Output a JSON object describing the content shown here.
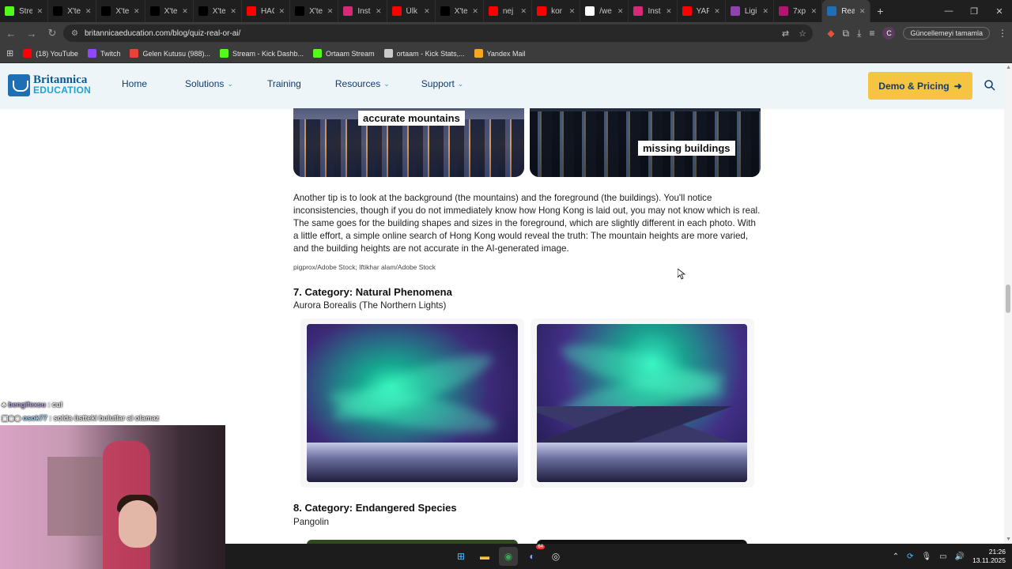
{
  "browser": {
    "tabs": [
      {
        "title": "Stre",
        "icon": "kick-icon",
        "color": "#53fc18"
      },
      {
        "title": "X'te",
        "icon": "x-icon",
        "color": "#000000"
      },
      {
        "title": "X'te",
        "icon": "x-icon",
        "color": "#000000"
      },
      {
        "title": "X'te",
        "icon": "x-icon",
        "color": "#000000"
      },
      {
        "title": "X'te",
        "icon": "x-icon",
        "color": "#000000"
      },
      {
        "title": "HAC",
        "icon": "youtube-icon",
        "color": "#ff0000"
      },
      {
        "title": "X'te",
        "icon": "x-icon",
        "color": "#000000"
      },
      {
        "title": "Inst",
        "icon": "instagram-icon",
        "color": "#d62976"
      },
      {
        "title": "Ülk",
        "icon": "youtube-icon",
        "color": "#ff0000"
      },
      {
        "title": "X'te",
        "icon": "x-icon",
        "color": "#000000"
      },
      {
        "title": "nej",
        "icon": "youtube-icon",
        "color": "#ff0000"
      },
      {
        "title": "kor",
        "icon": "youtube-icon",
        "color": "#ff0000"
      },
      {
        "title": "/we",
        "icon": "web-icon",
        "color": "#ffffff"
      },
      {
        "title": "Inst",
        "icon": "instagram-icon",
        "color": "#d62976"
      },
      {
        "title": "YAF",
        "icon": "youtube-icon",
        "color": "#ff0000"
      },
      {
        "title": "Ligi",
        "icon": "pen-icon",
        "color": "#8e44ad"
      },
      {
        "title": "7xp",
        "icon": "seven-icon",
        "color": "#b0186f"
      },
      {
        "title": "Rea",
        "icon": "britannica-icon",
        "color": "#1f6fb5",
        "active": true
      }
    ],
    "url": "britannicaeducation.com/blog/quiz-real-or-ai/",
    "update_label": "Güncellemeyi tamamla",
    "profile_initial": "C",
    "bookmarks": [
      {
        "label": "(18) YouTube",
        "icon": "youtube-icon",
        "color": "#ff0000"
      },
      {
        "label": "Twitch",
        "icon": "twitch-icon",
        "color": "#9146ff"
      },
      {
        "label": "Gelen Kutusu (988)...",
        "icon": "gmail-icon",
        "color": "#ea4335"
      },
      {
        "label": "Stream - Kick Dashb...",
        "icon": "kick-icon",
        "color": "#53fc18"
      },
      {
        "label": "Ortaam Stream",
        "icon": "kick-icon",
        "color": "#53fc18"
      },
      {
        "label": "ortaam - Kick Stats,...",
        "icon": "stats-icon",
        "color": "#cccccc"
      },
      {
        "label": "Yandex Mail",
        "icon": "mail-icon",
        "color": "#f5a623"
      }
    ]
  },
  "site": {
    "logo_line1": "Britannica",
    "logo_line2": "EDUCATION",
    "nav": [
      {
        "label": "Home",
        "dropdown": false
      },
      {
        "label": "Solutions",
        "dropdown": true
      },
      {
        "label": "Training",
        "dropdown": false
      },
      {
        "label": "Resources",
        "dropdown": true
      },
      {
        "label": "Support",
        "dropdown": true
      }
    ],
    "cta_label": "Demo & Pricing"
  },
  "article": {
    "image_labels": [
      "accurate mountains",
      "missing buildings"
    ],
    "paragraph": "Another tip is to look at the background (the mountains) and the foreground (the buildings). You'll notice inconsistencies, though if you do not immediately know how Hong Kong is laid out, you may not know which is real. The same goes for the building shapes and sizes in the foreground, which are slightly different in each photo. With a little effort, a simple online search of Hong Kong would reveal the truth: The mountain heights are more varied, and the building heights are not accurate in the AI-generated image.",
    "caption": "pigprox/Adobe Stock; Iftikhar alam/Adobe Stock",
    "section7_title": "7. Category: Natural Phenomena",
    "section7_sub": "Aurora Borealis (The Northern Lights)",
    "section8_title": "8. Category: Endangered Species",
    "section8_sub": "Pangolin"
  },
  "stream_overlay": {
    "chat": [
      {
        "user": "bengifexsu",
        "message": " : cul"
      },
      {
        "user": "osok77",
        "message": " : solda üstteki bulutlar ai olamaz"
      }
    ]
  },
  "taskbar": {
    "time": "21:26",
    "date": "13.11.2025",
    "discord_badge": "64"
  }
}
